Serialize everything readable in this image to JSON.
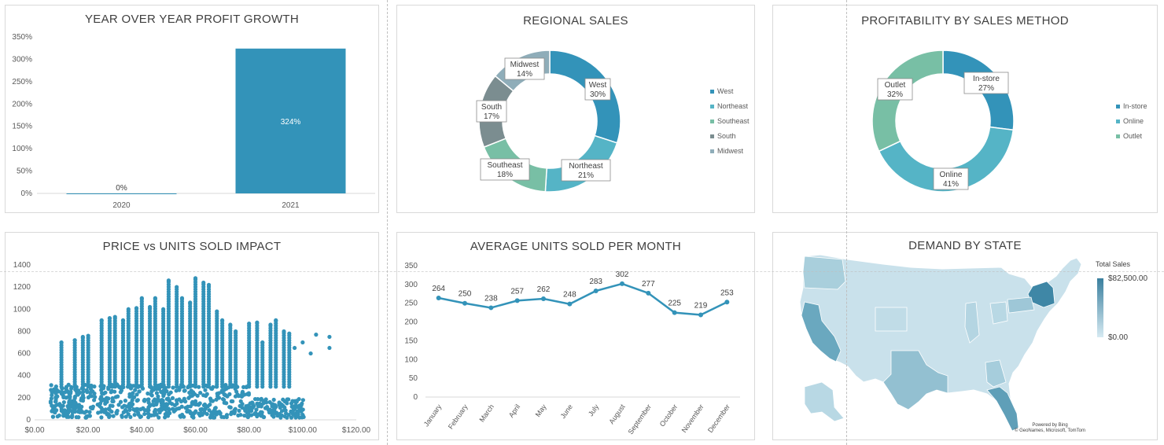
{
  "colors": {
    "blue": "#3393b9",
    "teal": "#55b4c6",
    "green": "#78bfa5",
    "grey": "#7b8d90",
    "slate": "#8fadb9",
    "gridline": "#d9d9d9",
    "map_high": "#3a7f9e",
    "map_low": "#d6eaf2"
  },
  "charts": {
    "profit_growth": {
      "title": "YEAR OVER YEAR PROFIT GROWTH",
      "chart_data": {
        "type": "bar",
        "categories": [
          "2020",
          "2021"
        ],
        "values": [
          0,
          324
        ],
        "data_labels": [
          "0%",
          "324%"
        ],
        "ylim": [
          0,
          350
        ],
        "y_ticks": [
          "0%",
          "50%",
          "100%",
          "150%",
          "200%",
          "250%",
          "300%",
          "350%"
        ]
      }
    },
    "regional_sales": {
      "title": "REGIONAL SALES",
      "chart_data": {
        "type": "pie",
        "donut": true,
        "categories": [
          "West",
          "Northeast",
          "Southeast",
          "South",
          "Midwest"
        ],
        "values": [
          30,
          21,
          18,
          17,
          14
        ],
        "data_labels": [
          "30%",
          "21%",
          "18%",
          "17%",
          "14%"
        ],
        "legend": "right"
      }
    },
    "sales_method": {
      "title": "PROFITABILITY BY SALES METHOD",
      "chart_data": {
        "type": "pie",
        "donut": true,
        "categories": [
          "In-store",
          "Online",
          "Outlet"
        ],
        "values": [
          27,
          41,
          32
        ],
        "data_labels": [
          "27%",
          "41%",
          "32%"
        ],
        "legend": "right"
      }
    },
    "price_units": {
      "title": "PRICE vs UNITS SOLD IMPACT",
      "chart_data": {
        "type": "scatter",
        "xlim": [
          0,
          120
        ],
        "ylim": [
          0,
          1400
        ],
        "x_ticks": [
          "$0.00",
          "$20.00",
          "$40.00",
          "$60.00",
          "$80.00",
          "$100.00",
          "$120.00"
        ],
        "y_ticks": [
          "0",
          "200",
          "400",
          "600",
          "800",
          "1000",
          "1200",
          "1400"
        ],
        "columns": [
          [
            10,
            700
          ],
          [
            15,
            720
          ],
          [
            18,
            750
          ],
          [
            20,
            760
          ],
          [
            25,
            900
          ],
          [
            28,
            920
          ],
          [
            30,
            930
          ],
          [
            33,
            900
          ],
          [
            35,
            1000
          ],
          [
            38,
            1010
          ],
          [
            40,
            1100
          ],
          [
            43,
            1020
          ],
          [
            45,
            1100
          ],
          [
            48,
            1000
          ],
          [
            50,
            1260
          ],
          [
            53,
            1200
          ],
          [
            55,
            1100
          ],
          [
            58,
            1060
          ],
          [
            60,
            1280
          ],
          [
            63,
            1240
          ],
          [
            65,
            1220
          ],
          [
            68,
            980
          ],
          [
            70,
            900
          ],
          [
            73,
            860
          ],
          [
            75,
            800
          ],
          [
            80,
            870
          ],
          [
            83,
            880
          ],
          [
            85,
            700
          ],
          [
            88,
            860
          ],
          [
            90,
            900
          ],
          [
            93,
            800
          ],
          [
            95,
            780
          ]
        ],
        "high_points": [
          [
            97,
            650
          ],
          [
            100,
            700
          ],
          [
            103,
            600
          ],
          [
            105,
            770
          ],
          [
            110,
            750
          ],
          [
            110,
            650
          ]
        ]
      }
    },
    "avg_units": {
      "title": "AVERAGE UNITS SOLD PER MONTH",
      "chart_data": {
        "type": "line",
        "categories": [
          "January",
          "February",
          "March",
          "April",
          "May",
          "June",
          "July",
          "August",
          "September",
          "October",
          "November",
          "December"
        ],
        "values": [
          264,
          250,
          238,
          257,
          262,
          248,
          283,
          302,
          277,
          225,
          219,
          253
        ],
        "ylim": [
          0,
          350
        ],
        "y_ticks": [
          "0",
          "50",
          "100",
          "150",
          "200",
          "250",
          "300",
          "350"
        ]
      }
    },
    "demand_state": {
      "title": "DEMAND BY STATE",
      "legend_title": "Total Sales",
      "legend_max": "$82,500.00",
      "legend_min": "$0.00",
      "footnote_1": "Powered by Bing",
      "footnote_2": "© GeoNames, Microsoft, TomTom"
    }
  }
}
